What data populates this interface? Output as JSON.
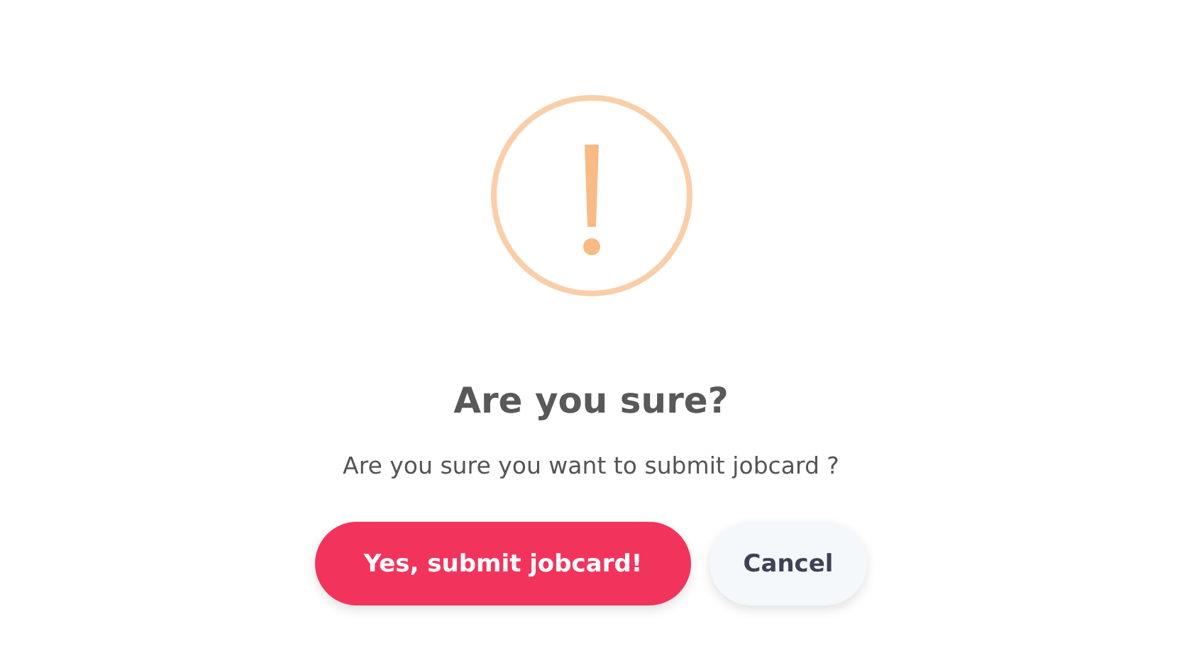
{
  "dialog": {
    "title": "Are you sure?",
    "message": "Are you sure you want to submit jobcard ?",
    "buttons": [
      {
        "label": "Yes, submit jobcard!",
        "kind": "confirm"
      },
      {
        "label": "Cancel",
        "kind": "cancel"
      }
    ]
  }
}
